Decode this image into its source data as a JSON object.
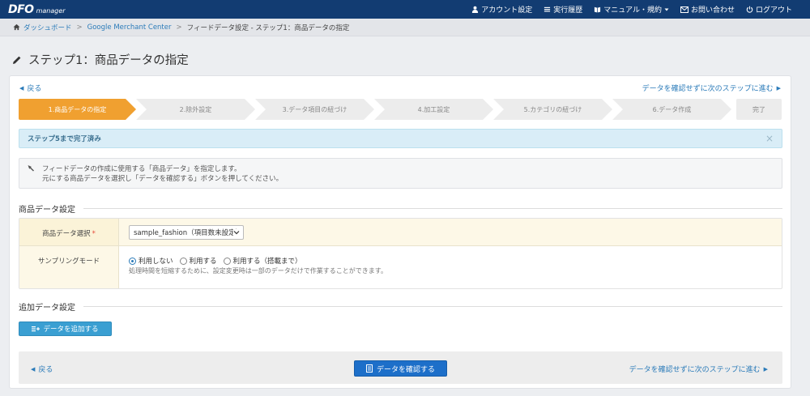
{
  "header": {
    "logo_main": "DFO",
    "logo_sub": "manager",
    "nav": [
      {
        "label": "アカウント設定",
        "icon": "user-icon"
      },
      {
        "label": "実行履歴",
        "icon": "list-icon"
      },
      {
        "label": "マニュアル・規約",
        "icon": "book-icon"
      },
      {
        "label": "お問い合わせ",
        "icon": "mail-icon"
      },
      {
        "label": "ログアウト",
        "icon": "power-icon"
      }
    ]
  },
  "breadcrumb": {
    "items": [
      "ダッシュボード",
      "Google Merchant Center",
      "フィードデータ設定 - ステップ1：商品データの指定"
    ]
  },
  "page": {
    "title": "ステップ1：商品データの指定"
  },
  "nav_links": {
    "back": "戻る",
    "skip": "データを確認せずに次のステップに進む"
  },
  "steps": [
    {
      "label": "1.商品データの指定",
      "active": true
    },
    {
      "label": "2.除外設定",
      "active": false
    },
    {
      "label": "3.データ項目の紐づけ",
      "active": false
    },
    {
      "label": "4.加工設定",
      "active": false
    },
    {
      "label": "5.カテゴリの紐づけ",
      "active": false
    },
    {
      "label": "6.データ作成",
      "active": false
    },
    {
      "label": "完了",
      "active": false
    }
  ],
  "alert": {
    "text": "ステップ5まで完了済み",
    "close": "×"
  },
  "info": {
    "line1": "フィードデータの作成に使用する「商品データ」を指定します。",
    "line2": "元にする商品データを選択し「データを確認する」ボタンを押してください。"
  },
  "product_section": {
    "heading": "商品データ設定",
    "select_label": "商品データ選択",
    "required_mark": "*",
    "select_value": "sample_fashion（項目数未設定）",
    "sampling_label": "サンプリングモード",
    "radios": [
      {
        "label": "利用しない",
        "checked": true
      },
      {
        "label": "利用する",
        "checked": false
      },
      {
        "label": "利用する（搭載まで）",
        "checked": false
      }
    ],
    "hint": "処理時間を短縮するために、設定変更時は一部のデータだけで作業することができます。"
  },
  "additional_section": {
    "heading": "追加データ設定",
    "add_button": "データを追加する"
  },
  "footer": {
    "confirm_button": "データを確認する"
  },
  "colors": {
    "header_bg": "#123c72",
    "step_active": "#f0a030",
    "link": "#2b7bb9",
    "primary_button": "#1d6fc9"
  }
}
